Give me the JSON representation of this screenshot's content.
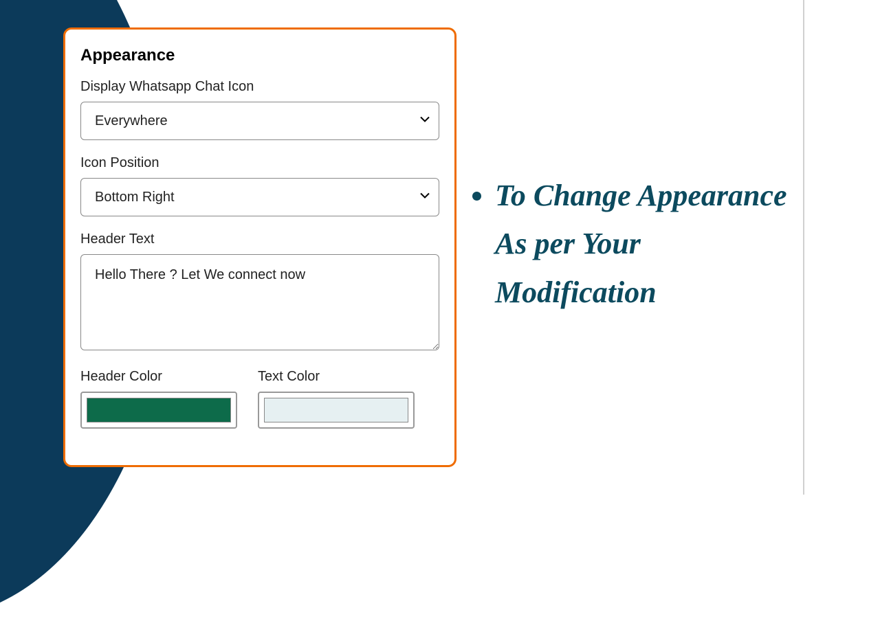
{
  "panel": {
    "title": "Appearance",
    "display_icon": {
      "label": "Display Whatsapp Chat Icon",
      "value": "Everywhere"
    },
    "icon_position": {
      "label": "Icon Position",
      "value": "Bottom Right"
    },
    "header_text": {
      "label": "Header Text",
      "value": "Hello There ? Let We connect now"
    },
    "header_color": {
      "label": "Header Color",
      "value": "#0d6b4a"
    },
    "text_color": {
      "label": "Text Color",
      "value": "#e6f0f2"
    }
  },
  "callout": {
    "text": "To Change Appearance As per Your Modification"
  }
}
